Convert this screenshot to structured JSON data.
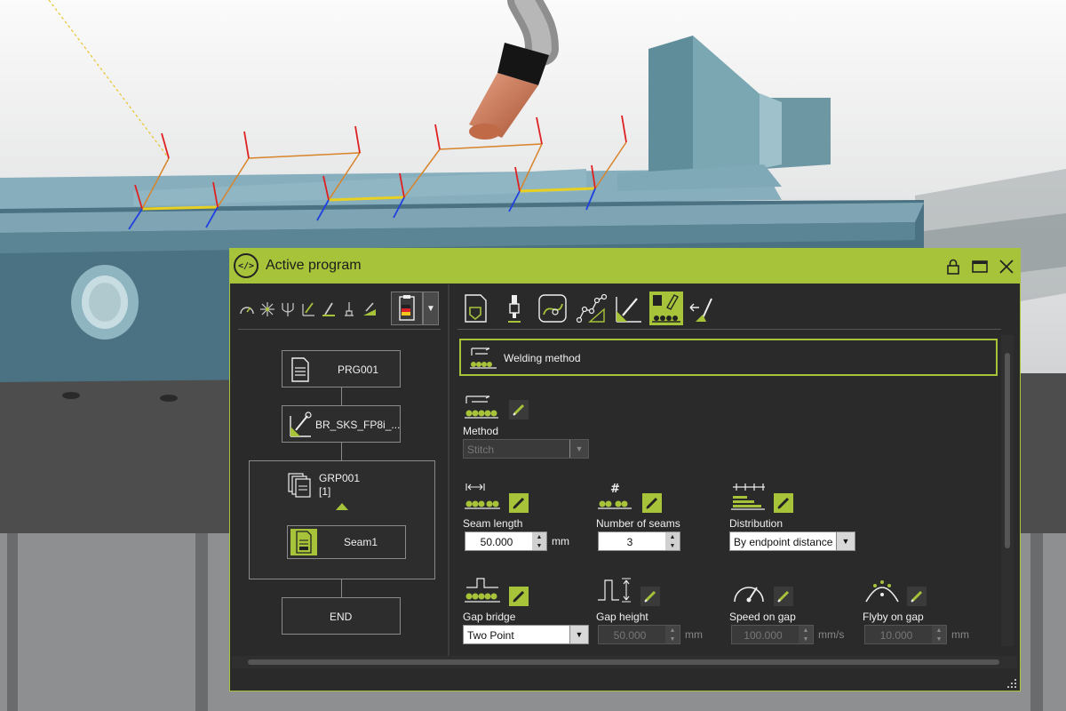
{
  "window": {
    "title": "Active program"
  },
  "program_tree": {
    "program": "PRG001",
    "tool": "BR_SKS_FP8i_...",
    "group_name": "GRP001",
    "group_count": "[1]",
    "seam": "Seam1",
    "end": "END"
  },
  "icons": {
    "program": "program-file-icon",
    "tool": "welding-torch-icon",
    "group": "group-stack-icon",
    "seam": "seam-file-icon"
  },
  "section": {
    "title": "Welding method"
  },
  "params": {
    "method": {
      "label": "Method",
      "value": "Stitch"
    },
    "seam_length": {
      "label": "Seam length",
      "value": "50.000",
      "unit": "mm"
    },
    "number_of_seams": {
      "label": "Number of seams",
      "value": "3"
    },
    "distribution": {
      "label": "Distribution",
      "value": "By endpoint distance"
    },
    "gap_bridge": {
      "label": "Gap bridge",
      "value": "Two Point"
    },
    "gap_height": {
      "label": "Gap height",
      "value": "50.000",
      "unit": "mm"
    },
    "speed_on_gap": {
      "label": "Speed on gap",
      "value": "100.000",
      "unit": "mm/s"
    },
    "flyby_on_gap": {
      "label": "Flyby on gap",
      "value": "10.000",
      "unit": "mm"
    }
  },
  "colors": {
    "accent": "#a7c33a",
    "panel": "#2a2a2a",
    "text": "#f0f0f0"
  }
}
